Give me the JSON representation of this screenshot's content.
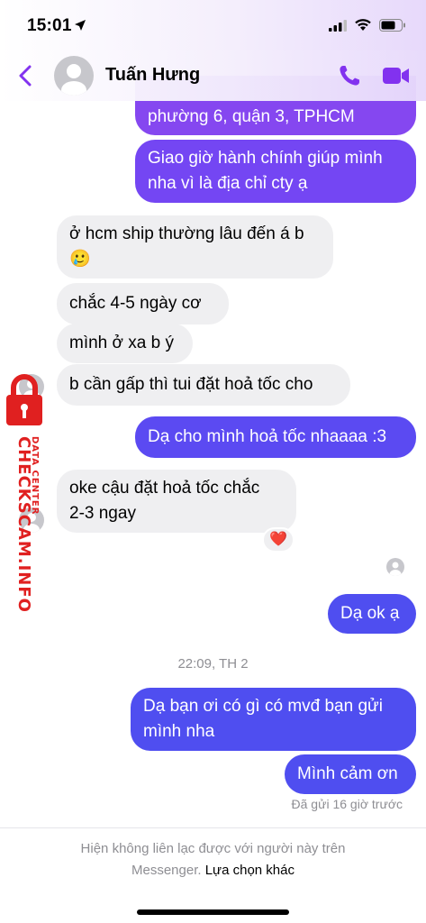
{
  "status_bar": {
    "time": "15:01"
  },
  "header": {
    "contact_name": "Tuấn Hưng"
  },
  "messages": {
    "m0": "phường 6, quận 3, TPHCM",
    "m1_line1": "Giao giờ hành chính giúp mình",
    "m1_line2": "nha vì là địa chỉ cty ạ",
    "m2_line1": "ở hcm ship thường lâu đến á b",
    "m2_emoji": "🥲",
    "m3": "chắc 4-5 ngày cơ",
    "m4": "mình ở xa b ý",
    "m5": "b cần gấp thì tui đặt hoả tốc cho",
    "m6": "Dạ cho mình hoả tốc nhaaaa :3",
    "m7_line1": "oke cậu đặt hoả tốc chắc",
    "m7_line2": "2-3 ngay",
    "m7_reaction": "❤️",
    "m8": "Dạ ok ạ",
    "m9_line1": "Dạ bạn ơi có gì có mvđ bạn gửi",
    "m9_line2": "mình nha",
    "m10": "Mình cảm ơn"
  },
  "timestamp": "22:09, TH 2",
  "sent_status": "Đã gửi 16 giờ trước",
  "footer": {
    "line1": "Hiện không liên lạc được với người này trên",
    "line2_prefix": "Messenger.",
    "link": "Lựa chọn khác"
  },
  "watermark": {
    "main": "CHECKSCAM.INFO",
    "sub": "DATA CENTER"
  },
  "colors": {
    "accent": "#7b3ff2",
    "outgoing": "#6b45f5",
    "incoming": "#efeff1",
    "watermark": "#e02020"
  },
  "icons": [
    "location-arrow-icon",
    "signal-icon",
    "wifi-icon",
    "battery-icon",
    "back-chevron-icon",
    "phone-icon",
    "video-camera-icon",
    "lock-icon"
  ]
}
